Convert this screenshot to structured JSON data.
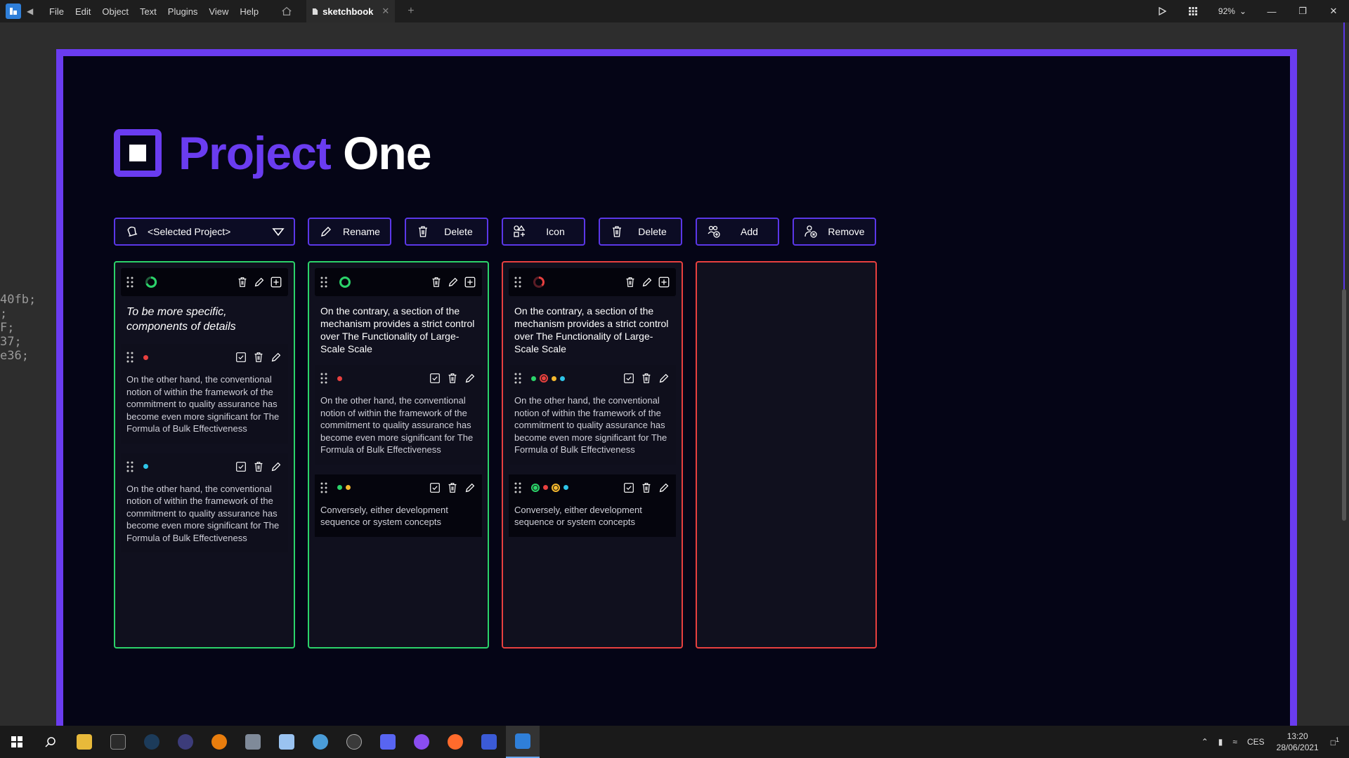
{
  "appbar": {
    "menu": [
      "File",
      "Edit",
      "Object",
      "Text",
      "Plugins",
      "View",
      "Help"
    ],
    "tab_title": "sketchbook",
    "zoom": "92%"
  },
  "side_code": [
    "40fb;",
    "",
    ";",
    "F;",
    "",
    "37;",
    "e36;"
  ],
  "page": {
    "title_part1": "Project",
    "title_part2": "One"
  },
  "toolbar": {
    "select_label": "<Selected Project>",
    "rename": "Rename",
    "delete1": "Delete",
    "icon": "Icon",
    "delete2": "Delete",
    "add": "Add",
    "remove": "Remove"
  },
  "columns": [
    {
      "border": "green",
      "status": "partial-green",
      "title": "To be more specific, components of details",
      "cards": [
        {
          "dots": [
            "#e8403f"
          ],
          "text": "On the other hand, the conventional notion of within the framework of the commitment to quality assurance has become even more significant for The Formula of Bulk Effectiveness"
        },
        {
          "dots": [
            "#2ec5e8"
          ],
          "text": "On the other hand, the conventional notion of within the framework of the commitment to quality assurance has become even more significant for The Formula of Bulk Effectiveness"
        }
      ]
    },
    {
      "border": "green",
      "status": "full-green",
      "title": "On the contrary, a section of the mechanism provides a strict control over The Functionality of Large-Scale Scale",
      "cards": [
        {
          "dots": [
            "#e8403f"
          ],
          "text": "On the other hand, the conventional notion of within the framework of the commitment to quality assurance has become even more significant for The Formula of Bulk Effectiveness"
        },
        {
          "dots": [
            "#2bd36a",
            "#f5b82e"
          ],
          "text": "Conversely, either development sequence or system concepts"
        }
      ]
    },
    {
      "border": "red",
      "status": "partial-red",
      "title": "On the contrary, a section of the mechanism provides a strict control over The Functionality of Large-Scale Scale",
      "cards": [
        {
          "dots": [
            "#2bd36a",
            "ring:#e8403f",
            "#f5b82e",
            "#2ec5e8"
          ],
          "text": "On the other hand, the conventional notion of within the framework of the commitment to quality assurance has become even more significant for The Formula of Bulk Effectiveness"
        },
        {
          "dots": [
            "ring:#2bd36a",
            "#e8403f",
            "ring:#f5b82e",
            "#2ec5e8"
          ],
          "text": "Conversely, either development sequence or system concepts"
        }
      ]
    },
    {
      "border": "red",
      "status": "",
      "title": "",
      "cards": []
    }
  ],
  "colors": {
    "accent": "#6a3cf0",
    "green": "#2bd36a",
    "red": "#e8403f",
    "yellow": "#f5b82e",
    "cyan": "#2ec5e8"
  },
  "tray": {
    "language": "CES",
    "time": "13:20",
    "date": "28/06/2021",
    "notifications": "1"
  }
}
